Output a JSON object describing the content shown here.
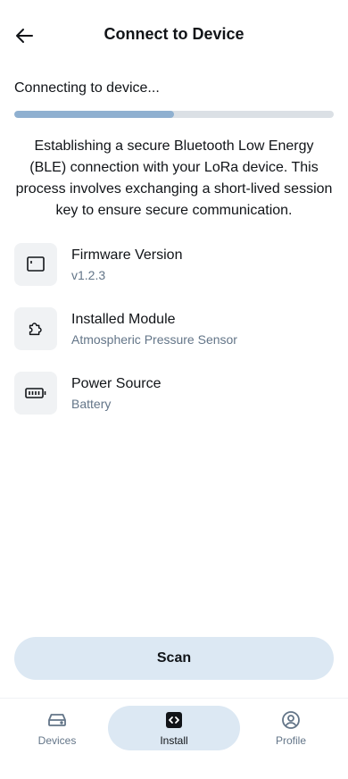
{
  "header": {
    "title": "Connect to Device",
    "back_icon": "arrow-left-icon"
  },
  "status": {
    "text": "Connecting to device...",
    "progress": 0.5
  },
  "description": "Establishing a secure Bluetooth Low Energy (BLE) connection with your LoRa device. This process involves exchanging a short-lived session key to ensure secure communication.",
  "info": [
    {
      "icon": "firmware-icon",
      "label": "Firmware Version",
      "value": "v1.2.3"
    },
    {
      "icon": "puzzle-icon",
      "label": "Installed Module",
      "value": "Atmospheric Pressure Sensor"
    },
    {
      "icon": "battery-icon",
      "label": "Power Source",
      "value": "Battery"
    }
  ],
  "scan_button": {
    "label": "Scan"
  },
  "nav": [
    {
      "icon": "device-icon",
      "label": "Devices",
      "active": false
    },
    {
      "icon": "code-icon",
      "label": "Install",
      "active": true
    },
    {
      "icon": "profile-icon",
      "label": "Profile",
      "active": false
    }
  ],
  "colors": {
    "accent": "#8fb0d0",
    "track": "#dbe0e5",
    "button_bg": "#dce8f3",
    "muted_text": "#637588",
    "icon_bg": "#f0f2f4"
  }
}
